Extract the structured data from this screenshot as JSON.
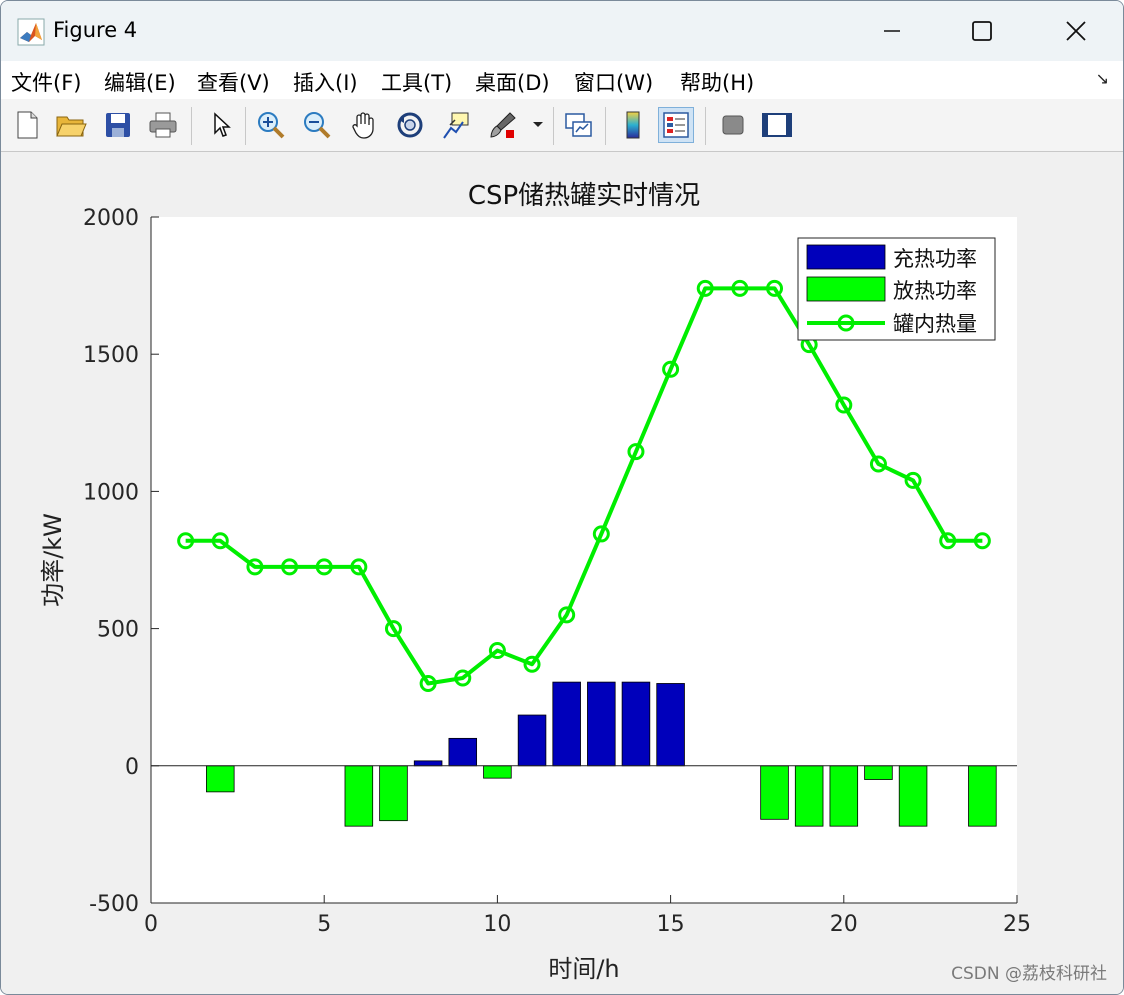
{
  "window": {
    "title": "Figure 4"
  },
  "menu": [
    {
      "label": "文件(F)"
    },
    {
      "label": "编辑(E)"
    },
    {
      "label": "查看(V)"
    },
    {
      "label": "插入(I)"
    },
    {
      "label": "工具(T)"
    },
    {
      "label": "桌面(D)"
    },
    {
      "label": "窗口(W)"
    },
    {
      "label": "帮助(H)"
    }
  ],
  "toolbar": [
    {
      "icon": "new-figure-icon"
    },
    {
      "icon": "open-folder-icon"
    },
    {
      "icon": "save-icon"
    },
    {
      "icon": "print-icon"
    },
    {
      "icon": "pointer-icon"
    },
    {
      "icon": "zoom-in-icon"
    },
    {
      "icon": "zoom-out-icon"
    },
    {
      "icon": "pan-hand-icon"
    },
    {
      "icon": "rotate-3d-icon"
    },
    {
      "icon": "data-cursor-icon"
    },
    {
      "icon": "brush-icon"
    },
    {
      "icon": "link-plot-icon"
    },
    {
      "icon": "colorbar-icon"
    },
    {
      "icon": "legend-icon"
    },
    {
      "icon": "hide-plot-tools-icon"
    },
    {
      "icon": "show-plot-tools-icon"
    }
  ],
  "watermark": "CSDN @荔枝科研社",
  "chart_data": {
    "type": "bar",
    "title": "CSP储热罐实时情况",
    "xlabel": "时间/h",
    "ylabel": "功率/kW",
    "xlim": [
      0,
      25
    ],
    "ylim": [
      -500,
      2000
    ],
    "xticks": [
      0,
      5,
      10,
      15,
      20,
      25
    ],
    "yticks": [
      -500,
      0,
      500,
      1000,
      1500,
      2000
    ],
    "legend_position": "top-right",
    "grid": false,
    "series": [
      {
        "name": "充热功率",
        "kind": "bar",
        "color": "#0000bb",
        "x": [
          8,
          9,
          11,
          12,
          13,
          14,
          15
        ],
        "values": [
          18,
          100,
          185,
          305,
          305,
          305,
          300
        ]
      },
      {
        "name": "放热功率",
        "kind": "bar",
        "color": "#00ff00",
        "x": [
          2,
          6,
          7,
          10,
          18,
          19,
          20,
          21,
          22,
          24
        ],
        "values": [
          -95,
          -220,
          -200,
          -45,
          -195,
          -220,
          -220,
          -50,
          -220,
          -220
        ]
      },
      {
        "name": "罐内热量",
        "kind": "line",
        "marker": "o",
        "color": "#00ee00",
        "x": [
          1,
          2,
          3,
          4,
          5,
          6,
          7,
          8,
          9,
          10,
          11,
          12,
          13,
          14,
          15,
          16,
          17,
          18,
          19,
          20,
          21,
          22,
          23,
          24
        ],
        "values": [
          820,
          820,
          725,
          725,
          725,
          725,
          500,
          300,
          320,
          420,
          370,
          550,
          845,
          1145,
          1445,
          1740,
          1740,
          1740,
          1535,
          1315,
          1100,
          1040,
          820,
          820
        ]
      }
    ]
  }
}
